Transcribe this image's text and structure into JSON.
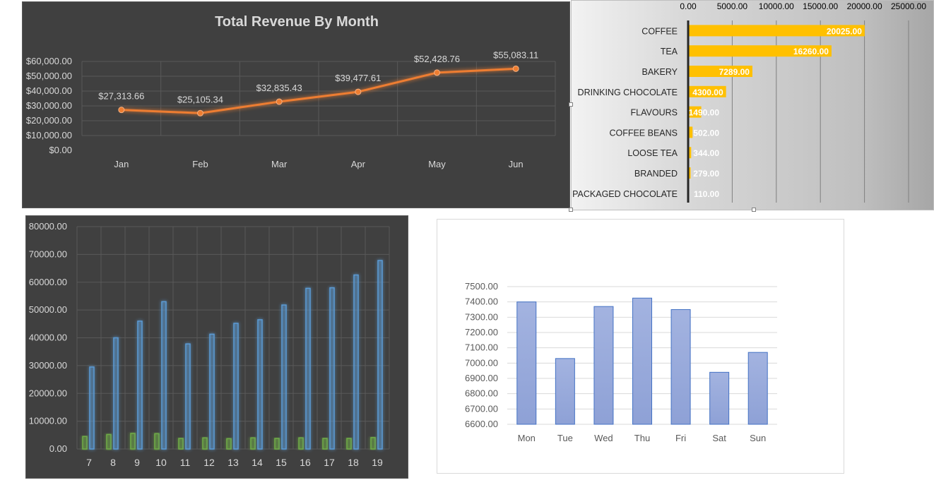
{
  "chart_data": [
    {
      "type": "line",
      "title": "Total Revenue By Month",
      "categories": [
        "Jan",
        "Feb",
        "Mar",
        "Apr",
        "May",
        "Jun"
      ],
      "values": [
        27313.66,
        25105.34,
        32835.43,
        39477.61,
        52428.76,
        55083.11
      ],
      "data_labels": [
        "$27,313.66",
        "$25,105.34",
        "$32,835.43",
        "$39,477.61",
        "$52,428.76",
        "$55,083.11"
      ],
      "ylim": [
        0,
        60000
      ],
      "y_ticks": [
        0,
        10000,
        20000,
        30000,
        40000,
        50000,
        60000
      ],
      "y_tick_labels": [
        "$0.00",
        "$10,000.00",
        "$20,000.00",
        "$30,000.00",
        "$40,000.00",
        "$50,000.00",
        "$60,000.00"
      ],
      "grid": true,
      "colors": {
        "background": "#404040",
        "line": "#ed7d31",
        "text": "#d9d9d9",
        "grid": "#595959"
      }
    },
    {
      "type": "bar",
      "orientation": "horizontal",
      "categories": [
        "COFFEE",
        "TEA",
        "BAKERY",
        "DRINKING CHOCOLATE",
        "FLAVOURS",
        "COFFEE BEANS",
        "LOOSE TEA",
        "BRANDED",
        "PACKAGED CHOCOLATE"
      ],
      "values": [
        20025,
        16260,
        7289,
        4300,
        1490,
        502,
        344,
        279,
        110
      ],
      "data_labels": [
        "20025.00",
        "16260.00",
        "7289.00",
        "4300.00",
        "1490.00",
        "502.00",
        "344.00",
        "279.00",
        "110.00"
      ],
      "xlim": [
        0,
        25000
      ],
      "x_ticks": [
        0,
        5000,
        10000,
        15000,
        20000,
        25000
      ],
      "x_tick_labels": [
        "0.00",
        "5000.00",
        "10000.00",
        "15000.00",
        "20000.00",
        "25000.00"
      ],
      "axis_position": "top",
      "grid": true,
      "colors": {
        "bar": "#ffc000",
        "text": "#262626",
        "label": "#ffffff",
        "grid": "#7f7f7f"
      }
    },
    {
      "type": "bar",
      "categories": [
        "7",
        "8",
        "9",
        "10",
        "11",
        "12",
        "13",
        "14",
        "15",
        "16",
        "17",
        "18",
        "19"
      ],
      "series": [
        {
          "values": [
            4500,
            5200,
            5600,
            5500,
            3800,
            4000,
            3700,
            4000,
            3800,
            4000,
            3800,
            3800,
            4100
          ]
        },
        {
          "values": [
            29500,
            40000,
            46000,
            53000,
            37800,
            41300,
            45200,
            46500,
            51800,
            57800,
            58000,
            62600,
            67800
          ]
        }
      ],
      "ylim": [
        0,
        80000
      ],
      "y_ticks": [
        0,
        10000,
        20000,
        30000,
        40000,
        50000,
        60000,
        70000,
        80000
      ],
      "y_tick_labels": [
        "0.00",
        "10000.00",
        "20000.00",
        "30000.00",
        "40000.00",
        "50000.00",
        "60000.00",
        "70000.00",
        "80000.00"
      ],
      "grid": true,
      "colors": {
        "background": "#404040",
        "series": [
          "#70ad47",
          "#5b9bd5"
        ],
        "text": "#d9d9d9",
        "grid": "#595959"
      }
    },
    {
      "type": "bar",
      "categories": [
        "Mon",
        "Tue",
        "Wed",
        "Thu",
        "Fri",
        "Sat",
        "Sun"
      ],
      "values": [
        7400,
        7030,
        7370,
        7425,
        7350,
        6940,
        7070
      ],
      "ylim": [
        6600,
        7500
      ],
      "y_ticks": [
        6600,
        6700,
        6800,
        6900,
        7000,
        7100,
        7200,
        7300,
        7400,
        7500
      ],
      "y_tick_labels": [
        "6600.00",
        "6700.00",
        "6800.00",
        "6900.00",
        "7000.00",
        "7100.00",
        "7200.00",
        "7300.00",
        "7400.00",
        "7500.00"
      ],
      "grid": true,
      "colors": {
        "bar_top": "#a3b3e0",
        "bar_bottom": "#8ea1d6",
        "bar_border": "#4472c4",
        "text": "#595959",
        "grid": "#d9d9d9"
      }
    }
  ]
}
